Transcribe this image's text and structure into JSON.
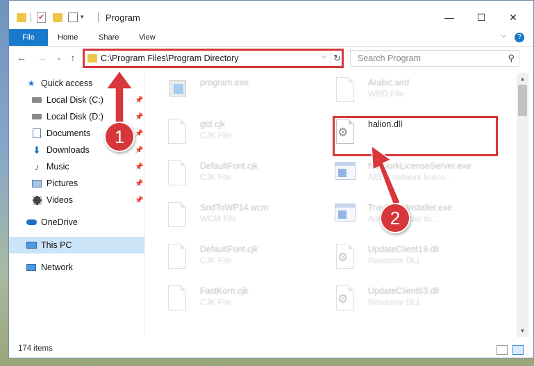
{
  "window": {
    "title": "Program",
    "controls": {
      "minimize": "—",
      "maximize": "☐",
      "close": "✕"
    }
  },
  "ribbon": {
    "tabs": [
      "File",
      "Home",
      "Share",
      "View"
    ]
  },
  "address_bar": {
    "path": "C:\\Program Files\\Program Directory"
  },
  "search": {
    "placeholder": "Search Program"
  },
  "sidebar": {
    "items": [
      {
        "label": "Quick access",
        "icon": "star-icon"
      },
      {
        "label": "Local Disk (C:)",
        "icon": "drive-icon"
      },
      {
        "label": "Local Disk (D:)",
        "icon": "drive-icon"
      },
      {
        "label": "Documents",
        "icon": "documents-icon"
      },
      {
        "label": "Downloads",
        "icon": "downloads-icon"
      },
      {
        "label": "Music",
        "icon": "music-icon"
      },
      {
        "label": "Pictures",
        "icon": "pictures-icon"
      },
      {
        "label": "Videos",
        "icon": "videos-icon"
      },
      {
        "label": "OneDrive",
        "icon": "cloud-icon"
      },
      {
        "label": "This PC",
        "icon": "computer-icon"
      },
      {
        "label": "Network",
        "icon": "network-icon"
      }
    ]
  },
  "files": [
    {
      "name": "program.exe",
      "type": ""
    },
    {
      "name": "Arabic.wrd",
      "type": "WRD File"
    },
    {
      "name": "gtd.cjk",
      "type": "CJK File"
    },
    {
      "name": "halion.dll",
      "type": ""
    },
    {
      "name": "DefaultFont.cjk",
      "type": "CJK File"
    },
    {
      "name": "NetworkLicenseServer.exe",
      "type": "ABBY network licens..."
    },
    {
      "name": "SndToWP14.wcm",
      "type": "WCM File"
    },
    {
      "name": "TrayIconsInstaller.exe",
      "type": "Adobe Reader tri..."
    },
    {
      "name": "DefaultFont.cjk",
      "type": "CJK File"
    },
    {
      "name": "UpdateClient19.dll",
      "type": "Resource DLL"
    },
    {
      "name": "FastKorn.cjk",
      "type": "CJK File"
    },
    {
      "name": "UpdateClient63.dll",
      "type": "Resource DLL"
    }
  ],
  "status": {
    "item_count": "174 items"
  },
  "annotations": {
    "step1": "1",
    "step2": "2",
    "color": "#d7373b"
  }
}
